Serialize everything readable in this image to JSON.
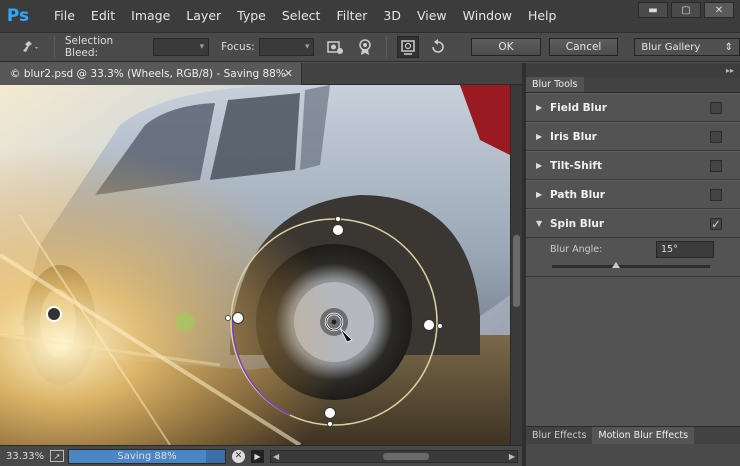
{
  "app": {
    "logo": "Ps"
  },
  "menu": [
    "File",
    "Edit",
    "Image",
    "Layer",
    "Type",
    "Select",
    "Filter",
    "3D",
    "View",
    "Window",
    "Help"
  ],
  "window_controls": [
    {
      "name": "minimize-icon",
      "glyph": "▬"
    },
    {
      "name": "maximize-icon",
      "glyph": "▢"
    },
    {
      "name": "close-icon",
      "glyph": "✕"
    }
  ],
  "options": {
    "tool_icon": "pin-icon",
    "selection_bleed_label": "Selection Bleed:",
    "focus_label": "Focus:",
    "ok_label": "OK",
    "cancel_label": "Cancel",
    "gallery_value": "Blur Gallery"
  },
  "document": {
    "tab_title": "© blur2.psd @ 33.3% (Wheels, RGB/8) - Saving 88%"
  },
  "status": {
    "zoom": "33.33%",
    "progress_label": "Saving 88%",
    "progress": 0.88
  },
  "panel": {
    "tab": "Blur Tools",
    "tools": [
      {
        "name": "Field Blur",
        "checked": false,
        "expanded": false
      },
      {
        "name": "Iris Blur",
        "checked": false,
        "expanded": false
      },
      {
        "name": "Tilt-Shift",
        "checked": false,
        "expanded": false
      },
      {
        "name": "Path Blur",
        "checked": false,
        "expanded": false
      },
      {
        "name": "Spin Blur",
        "checked": true,
        "expanded": true
      }
    ],
    "blur_angle_label": "Blur Angle:",
    "blur_angle_value": "15°",
    "blur_angle": 15,
    "bottom_tabs": [
      "Blur Effects",
      "Motion Blur Effects"
    ]
  }
}
